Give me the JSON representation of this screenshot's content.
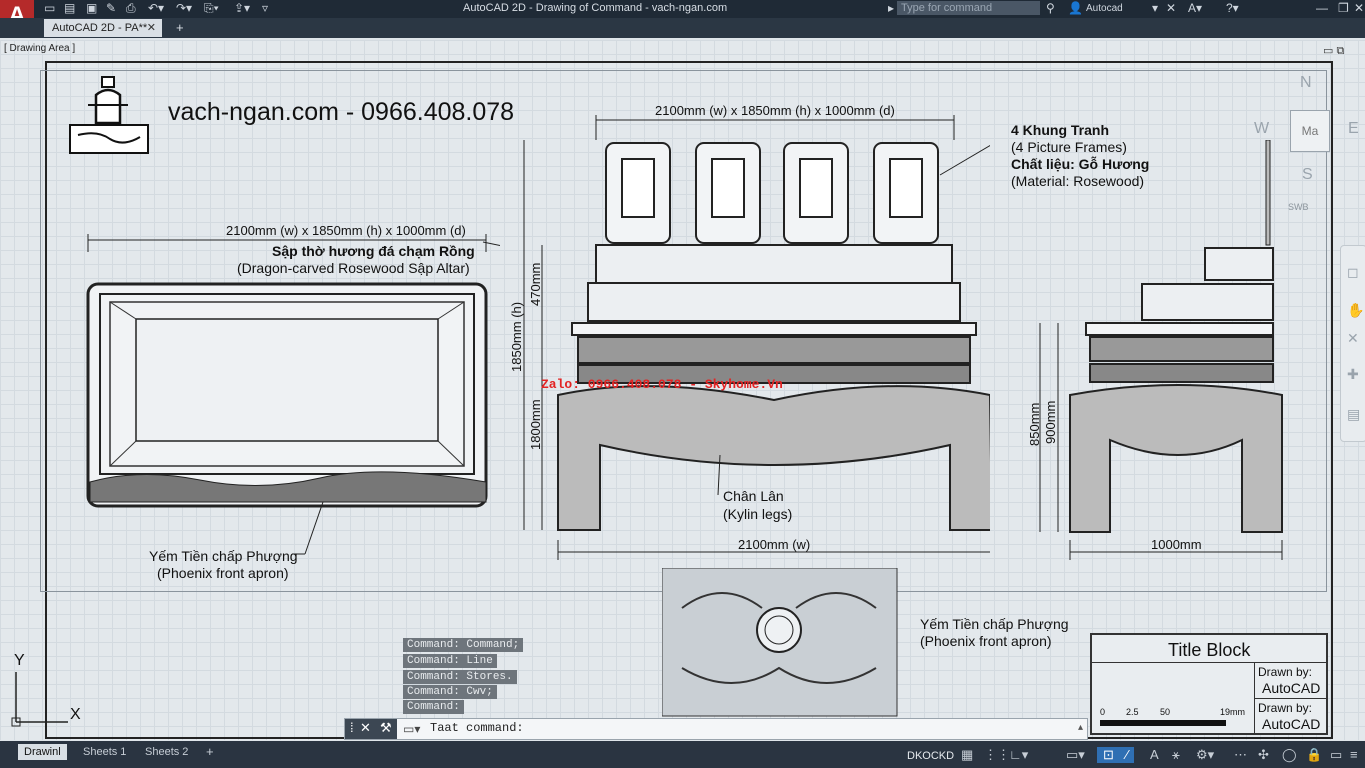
{
  "app": {
    "title": "AutoCAD 2D - Drawing of Command - vach-ngan.com",
    "logo_letter": "A",
    "search_placeholder": "Type for command",
    "user": "Autocad"
  },
  "tabs": {
    "doc_tab": "AutoCAD 2D - PA**"
  },
  "drawing_area_label": "[ Drawing Area ]",
  "drawing": {
    "site_title": "vach-ngan.com - 0966.408.078",
    "watermark": "Zalo: 0966.408.078 - Skyhome.Vn",
    "left_view": {
      "dim_top": "2100mm (w) x 1850mm (h) x 1000mm (d)",
      "name_vi": "Sập thờ hương đá chạm Rồng",
      "name_en": "(Dragon-carved Rosewood Sập Altar)",
      "apron_vi": "Yếm Tiền chấp Phượng",
      "apron_en": "(Phoenix front apron)"
    },
    "front_view": {
      "dim_top": "2100mm (w) x 1850mm (h) x 1000mm (d)",
      "dim_bottom": "2100mm (w)",
      "dim_470": "470mm",
      "dim_1850": "1850mm (h)",
      "dim_1800": "1800mm",
      "frames_vi": "4 Khung Tranh",
      "frames_en": "(4 Picture Frames)",
      "material_vi": "Chất liệu: Gỗ Hương",
      "material_en": "(Material: Rosewood)",
      "legs_vi": "Chân Lân",
      "legs_en": "(Kylin legs)"
    },
    "side_view": {
      "dim_bottom": "1000mm",
      "dim_850": "850mm",
      "dim_900": "900mm"
    },
    "detail": {
      "apron_vi": "Yếm Tiền chấp Phượng",
      "apron_en": "(Phoenix front apron)"
    },
    "title_block": {
      "heading": "Title Block",
      "drawn_by_1_label": "Drawn by:",
      "drawn_by_1_value": "AutoCAD",
      "drawn_by_2_label": "Drawn by:",
      "drawn_by_2_value": "AutoCAD",
      "scale_0": "0",
      "scale_1": "2.5",
      "scale_2": "50",
      "scale_unit": "19mm"
    }
  },
  "viewcube": {
    "n": "N",
    "s": "S",
    "e": "E",
    "w": "W",
    "face": "Ma",
    "wcs": "SWB"
  },
  "ucs": {
    "x": "X",
    "y": "Y"
  },
  "command": {
    "history": [
      "Command: Command;",
      "Command: Line",
      "Command: Stores.",
      "Command: Cwv;",
      "Command:"
    ],
    "input_placeholder": "Taat command:"
  },
  "layout_tabs": [
    "Drawinl",
    "Sheets 1",
    "Sheets 2"
  ],
  "status": {
    "coords": "DKOCKD"
  }
}
